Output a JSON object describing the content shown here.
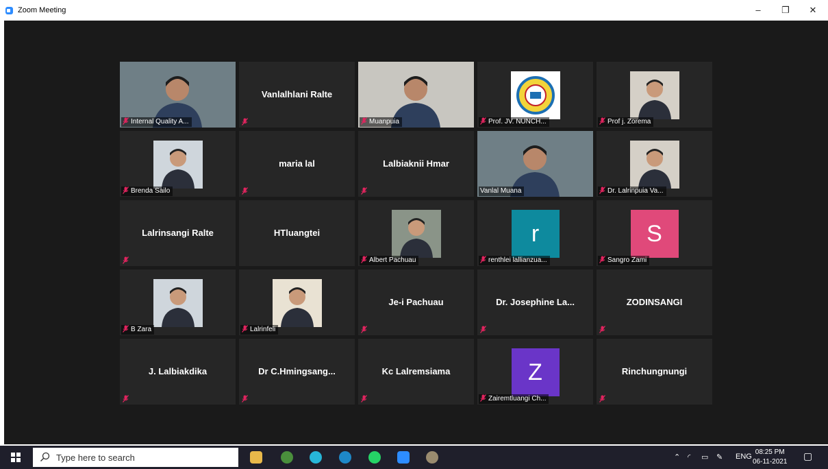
{
  "window": {
    "title": "Zoom Meeting",
    "minimize": "–",
    "restore": "❐",
    "close": "✕"
  },
  "colors": {
    "active_border": "#c7f07c",
    "mute_red": "#e0245e",
    "tile_bg": "#262626",
    "meeting_bg": "#1a1a1a"
  },
  "tiles": [
    {
      "name": "Internal Quality A...",
      "kind": "photo-video",
      "muted": true
    },
    {
      "name": "Vanlalhlani Ralte",
      "kind": "name-only",
      "muted": true
    },
    {
      "name": "Muanpuia",
      "kind": "photo-video",
      "muted": true
    },
    {
      "name": "Prof. JV. NUNCH...",
      "kind": "logo",
      "muted": true
    },
    {
      "name": "Prof j. Zorema",
      "kind": "photo",
      "muted": true
    },
    {
      "name": "Brenda Sailo",
      "kind": "photo",
      "muted": true
    },
    {
      "name": "maria lal",
      "kind": "name-only",
      "muted": true
    },
    {
      "name": "Lalbiaknii Hmar",
      "kind": "name-only",
      "muted": true
    },
    {
      "name": "Vanlal Muana",
      "kind": "photo-video",
      "muted": false,
      "active": true
    },
    {
      "name": "Dr. Lalrinpuia Va...",
      "kind": "photo",
      "muted": true
    },
    {
      "name": "Lalrinsangi Ralte",
      "kind": "name-only",
      "muted": true
    },
    {
      "name": "HTluangtei",
      "kind": "name-only",
      "muted": false
    },
    {
      "name": "Albert Pachuau",
      "kind": "photo",
      "muted": true
    },
    {
      "name": "renthlei lallianzua...",
      "kind": "letter",
      "letter": "r",
      "color": "#0e8a9e",
      "muted": true
    },
    {
      "name": "Sangro Zami",
      "kind": "letter",
      "letter": "S",
      "color": "#e0497a",
      "muted": true
    },
    {
      "name": "B Zara",
      "kind": "photo",
      "muted": true
    },
    {
      "name": "Lalrinfeli",
      "kind": "photo",
      "muted": true
    },
    {
      "name": "Je-i Pachuau",
      "kind": "name-only",
      "muted": true
    },
    {
      "name": "Dr. Josephine La...",
      "kind": "name-only",
      "muted": true
    },
    {
      "name": "ZODINSANGI",
      "kind": "name-only",
      "muted": true
    },
    {
      "name": "J. Lalbiakdika",
      "kind": "name-only",
      "muted": true
    },
    {
      "name": "Dr  C.Hmingsang...",
      "kind": "name-only",
      "muted": true
    },
    {
      "name": "Kc Lalremsiama",
      "kind": "name-only",
      "muted": true
    },
    {
      "name": "Zairemtluangi Ch...",
      "kind": "letter",
      "letter": "Z",
      "color": "#6a35c8",
      "muted": true
    },
    {
      "name": "Rinchungnungi",
      "kind": "name-only",
      "muted": true
    }
  ],
  "taskbar": {
    "search_placeholder": "Type here to search",
    "language": "ENG",
    "time": "08:25 PM",
    "date": "06-11-2021"
  }
}
